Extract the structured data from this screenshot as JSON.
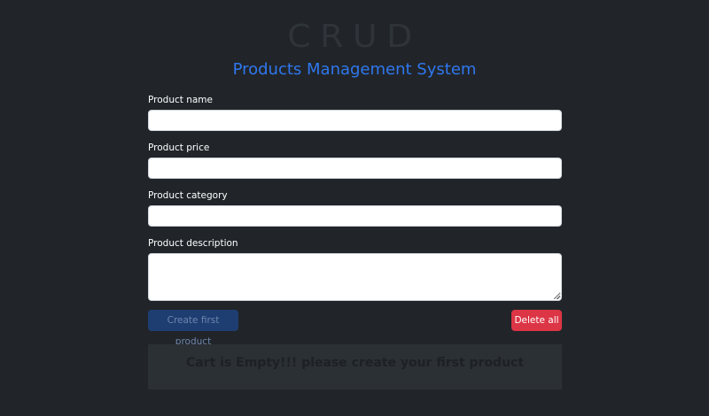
{
  "header": {
    "logo_text": "CRUD",
    "title": "Products Management System"
  },
  "form": {
    "name_label": "Product name",
    "name_value": "",
    "price_label": "Product price",
    "price_value": "",
    "category_label": "Product category",
    "category_value": "",
    "description_label": "Product description",
    "description_value": ""
  },
  "actions": {
    "create_label": "Create first product",
    "delete_label": "Delete all"
  },
  "cart": {
    "empty_message": "Cart is Empty!!! please create your first product"
  },
  "colors": {
    "background": "#212529",
    "title": "#2f77ef",
    "create_button": "#1e3e72",
    "delete_button": "#dc3545"
  }
}
